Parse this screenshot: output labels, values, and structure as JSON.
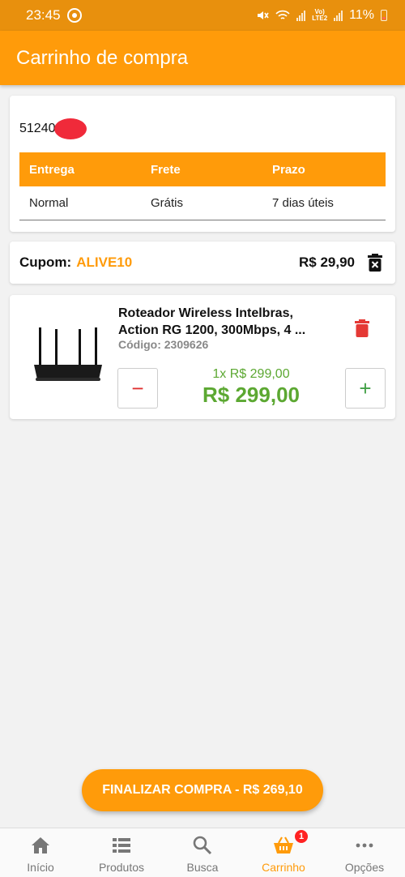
{
  "status_bar": {
    "time": "23:45",
    "battery": "11%"
  },
  "app_bar": {
    "title": "Carrinho de compra"
  },
  "delivery": {
    "cep": "51240",
    "headers": [
      "Entrega",
      "Frete",
      "Prazo"
    ],
    "row": [
      "Normal",
      "Grátis",
      "7 dias úteis"
    ]
  },
  "coupon": {
    "label": "Cupom:",
    "code": "ALIVE10",
    "value": "R$ 29,90"
  },
  "product": {
    "name": "Roteador Wireless Intelbras, Action RG 1200, 300Mbps, 4 ...",
    "code": "Código: 2309626",
    "unit_price": "1x R$ 299,00",
    "total_price": "R$ 299,00",
    "minus": "−",
    "plus": "+"
  },
  "checkout": {
    "label": "FINALIZAR COMPRA - R$ 269,10"
  },
  "bottom_nav": {
    "items": [
      {
        "label": "Início",
        "icon": "home-icon"
      },
      {
        "label": "Produtos",
        "icon": "list-icon"
      },
      {
        "label": "Busca",
        "icon": "search-icon"
      },
      {
        "label": "Carrinho",
        "icon": "basket-icon",
        "badge": "1",
        "active": true
      },
      {
        "label": "Opções",
        "icon": "more-icon"
      }
    ]
  },
  "colors": {
    "primary": "#ff9b0a",
    "status_bar": "#e8900d",
    "price_green": "#5ca832",
    "delete_red": "#e53935"
  }
}
